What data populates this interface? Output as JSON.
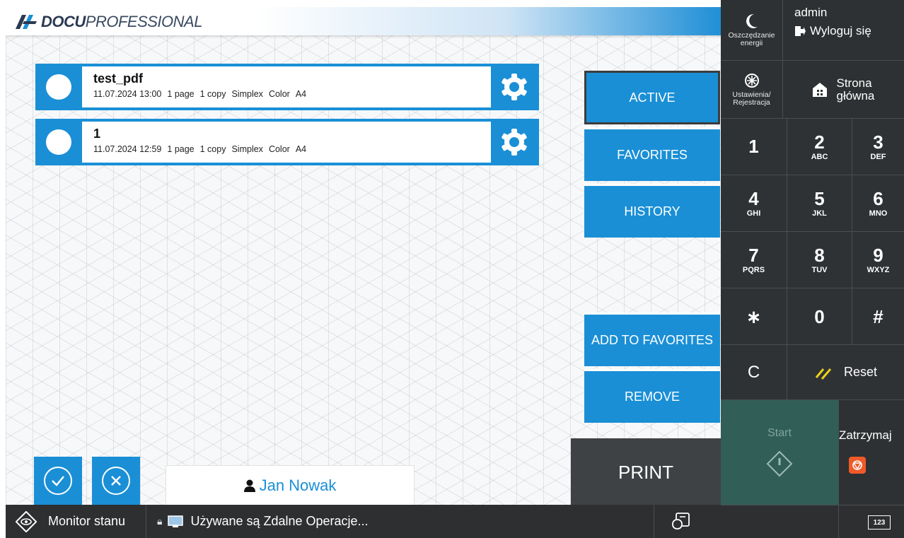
{
  "header": {
    "logo_bold": "DOCU",
    "logo_light": "PROFESSIONAL"
  },
  "jobs": [
    {
      "name": "test_pdf",
      "date": "11.07.2024 13:00",
      "pages": "1 page",
      "copies": "1 copy",
      "duplex": "Simplex",
      "color": "Color",
      "size": "A4"
    },
    {
      "name": "1",
      "date": "11.07.2024 12:59",
      "pages": "1 page",
      "copies": "1 copy",
      "duplex": "Simplex",
      "color": "Color",
      "size": "A4"
    }
  ],
  "tabs": {
    "active": "ACTIVE",
    "favorites": "FAVORITES",
    "history": "HISTORY"
  },
  "actions": {
    "add_to_favorites": "ADD TO FAVORITES",
    "remove": "REMOVE",
    "print": "PRINT"
  },
  "user": {
    "name": "Jan Nowak"
  },
  "statusbar": {
    "monitor": "Monitor stanu",
    "remote": "Używane są Zdalne Operacje..."
  },
  "panel": {
    "energy_saving": "Oszczędzanie energii",
    "username": "admin",
    "logout": "Wyloguj się",
    "settings": "Ustawienia/ Rejestracja",
    "home": "Strona główna",
    "keys": [
      {
        "num": "1",
        "sub": ""
      },
      {
        "num": "2",
        "sub": "ABC"
      },
      {
        "num": "3",
        "sub": "DEF"
      },
      {
        "num": "4",
        "sub": "GHI"
      },
      {
        "num": "5",
        "sub": "JKL"
      },
      {
        "num": "6",
        "sub": "MNO"
      },
      {
        "num": "7",
        "sub": "PQRS"
      },
      {
        "num": "8",
        "sub": "TUV"
      },
      {
        "num": "9",
        "sub": "WXYZ"
      },
      {
        "num": "∗",
        "sub": ""
      },
      {
        "num": "0",
        "sub": ""
      },
      {
        "num": "#",
        "sub": ""
      }
    ],
    "clear": "C",
    "reset": "Reset",
    "start": "Start",
    "stop": "Zatrzymaj",
    "keyboard": "123"
  },
  "colors": {
    "accent": "#1a8fd6",
    "panel_bg": "#2e3133",
    "start_bg": "#315e57",
    "print_bg": "#3f4244",
    "stop_icon": "#f05a28"
  }
}
